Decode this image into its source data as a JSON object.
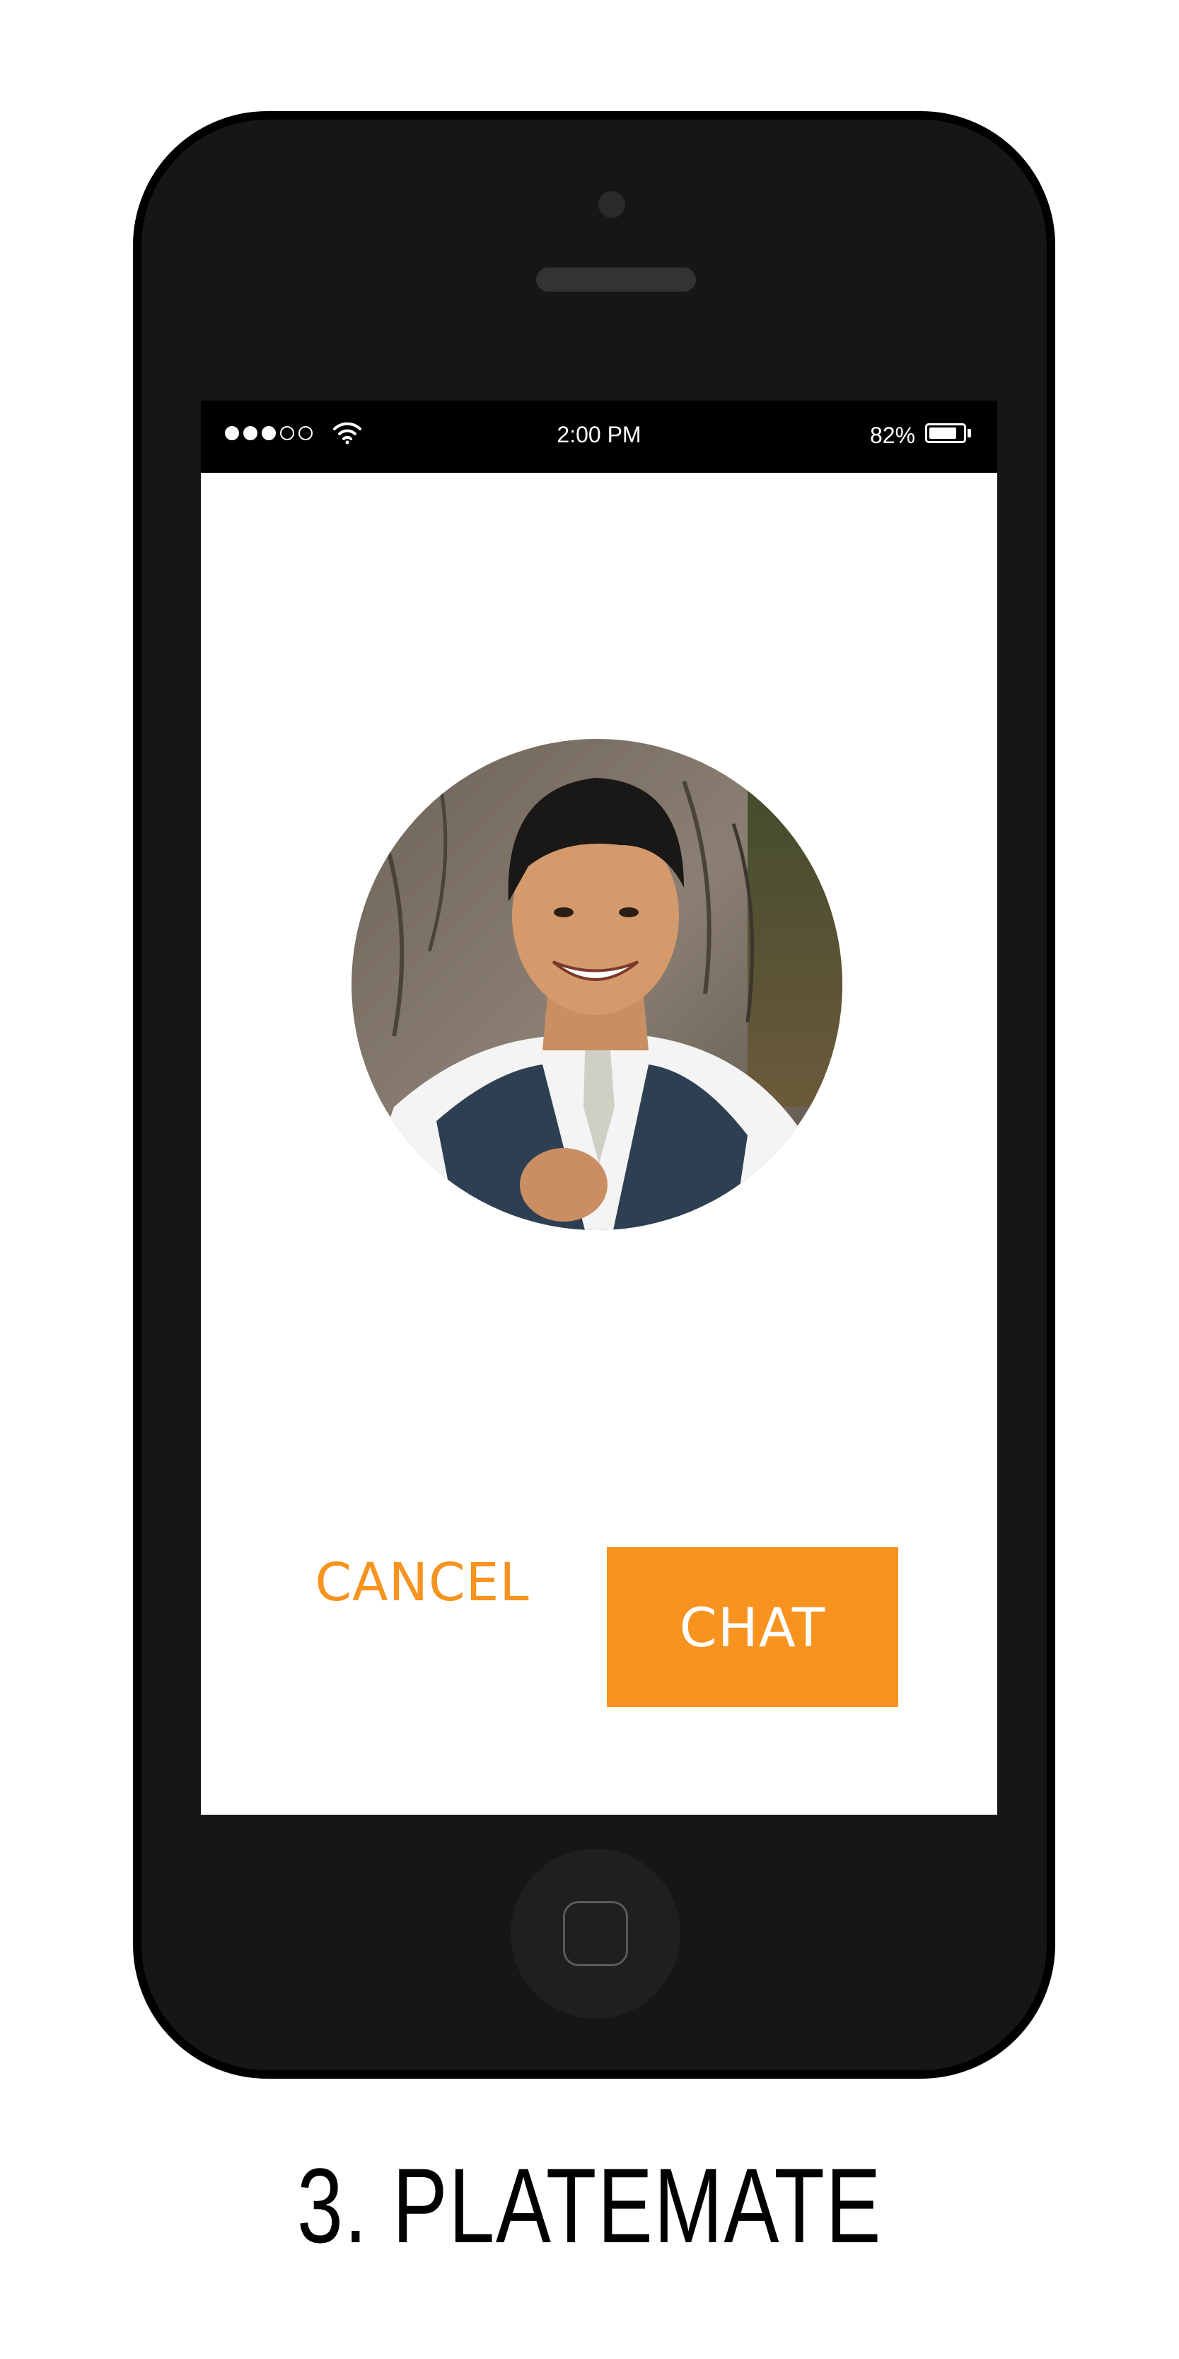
{
  "status_bar": {
    "signal_filled": 3,
    "signal_total": 5,
    "time": "2:00 PM",
    "battery_percent": "82%",
    "battery_level": 0.82
  },
  "profile": {
    "avatar_icon": "profile-photo"
  },
  "actions": {
    "cancel_label": "CANCEL",
    "chat_label": "CHAT"
  },
  "caption": "3. PLATEMATE",
  "colors": {
    "accent": "#f7931e",
    "phone_body": "#161616",
    "screen_bg": "#ffffff"
  }
}
